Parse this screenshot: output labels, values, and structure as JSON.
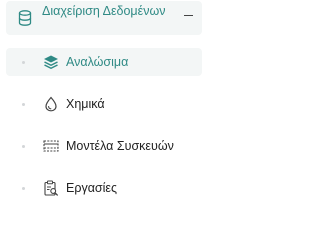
{
  "sidebar": {
    "group": {
      "title": "Διαχείριση Δεδομένων",
      "icon": "database-icon",
      "collapse_icon": "minus-icon",
      "expanded": true
    },
    "items": [
      {
        "label": "Αναλώσιμα",
        "icon": "layers-icon",
        "active": true
      },
      {
        "label": "Χημικά",
        "icon": "drop-icon",
        "active": false
      },
      {
        "label": "Μοντέλα Συσκευών",
        "icon": "device-icon",
        "active": false
      },
      {
        "label": "Εργασίες",
        "icon": "clipboard-search-icon",
        "active": false
      }
    ]
  },
  "colors": {
    "accent": "#2f8a85",
    "active_background": "#f3f6f6",
    "text": "#222222",
    "bullet": "#d3d6d8"
  }
}
